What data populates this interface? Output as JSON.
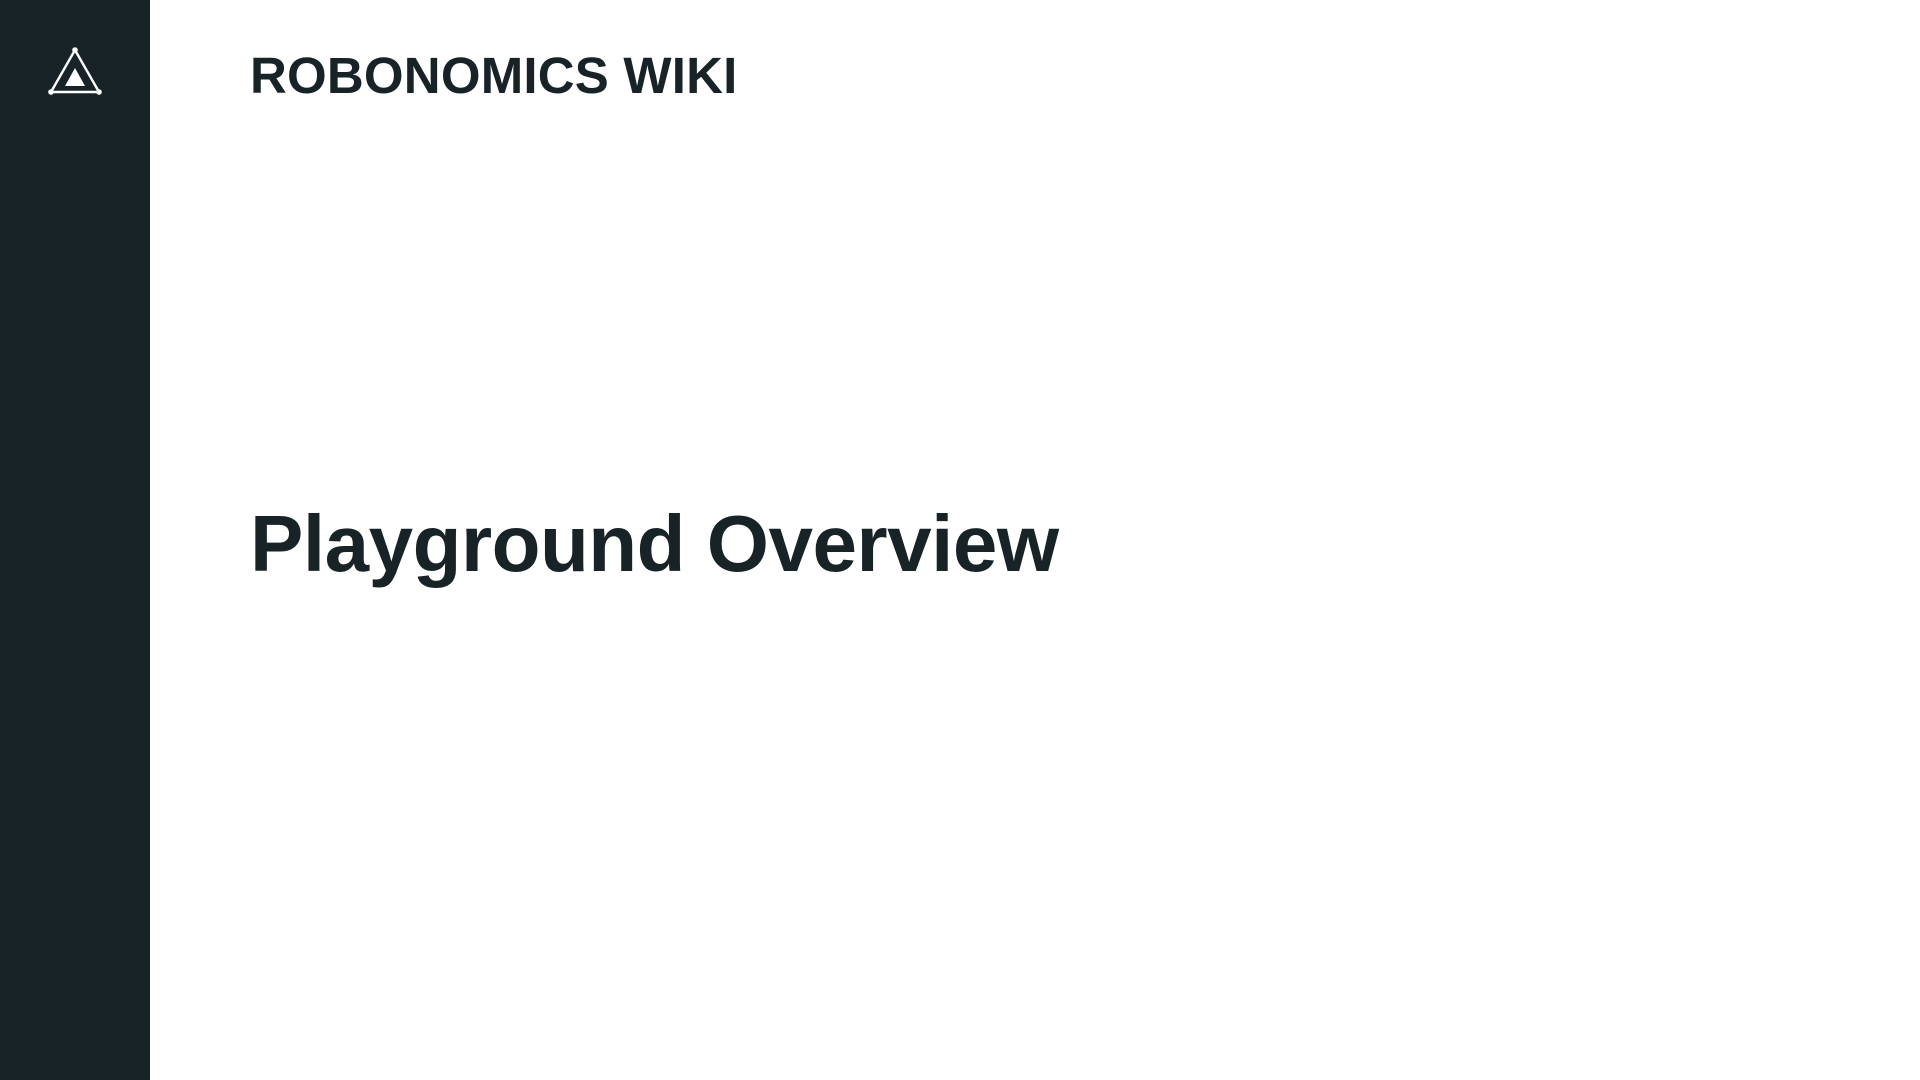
{
  "header": {
    "logo_icon": "robonomics-triangle-logo-icon",
    "site_title": "ROBONOMICS WIKI"
  },
  "main": {
    "page_title": "Playground Overview"
  },
  "colors": {
    "sidebar_background": "#182328",
    "text": "#182328",
    "page_background": "#ffffff",
    "logo_stroke": "#ffffff"
  }
}
